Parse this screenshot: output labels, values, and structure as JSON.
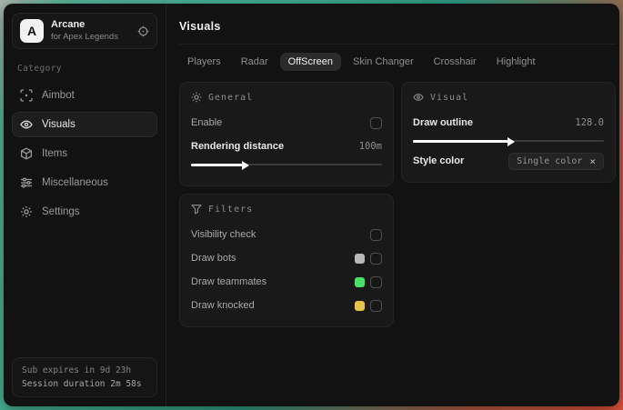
{
  "app": {
    "logo_letter": "A",
    "name": "Arcane",
    "subtitle": "for Apex Legends"
  },
  "sidebar": {
    "category_label": "Category",
    "items": [
      {
        "label": "Aimbot",
        "icon": "scan-icon",
        "active": false
      },
      {
        "label": "Visuals",
        "icon": "eye-icon",
        "active": true
      },
      {
        "label": "Items",
        "icon": "box-icon",
        "active": false
      },
      {
        "label": "Miscellaneous",
        "icon": "sliders-icon",
        "active": false
      },
      {
        "label": "Settings",
        "icon": "gear-icon",
        "active": false
      }
    ],
    "footer": {
      "line1": "Sub expires in 9d 23h",
      "line2": "Session duration 2m 58s"
    }
  },
  "main": {
    "title": "Visuals",
    "tabs": [
      {
        "label": "Players",
        "active": false
      },
      {
        "label": "Radar",
        "active": false
      },
      {
        "label": "OffScreen",
        "active": true
      },
      {
        "label": "Skin Changer",
        "active": false
      },
      {
        "label": "Crosshair",
        "active": false
      },
      {
        "label": "Highlight",
        "active": false
      }
    ],
    "general": {
      "title": "General",
      "enable_label": "Enable",
      "enable_checked": false,
      "rendering_label": "Rendering distance",
      "rendering_value": "100m",
      "rendering_fill": "27%"
    },
    "filters": {
      "title": "Filters",
      "rows": [
        {
          "label": "Visibility check",
          "checked": false
        },
        {
          "label": "Draw bots",
          "swatch": "#b8b8b8",
          "checked": false
        },
        {
          "label": "Draw teammates",
          "swatch": "#4ade6b",
          "checked": false
        },
        {
          "label": "Draw knocked",
          "swatch": "#e3c44d",
          "checked": false
        }
      ]
    },
    "visual": {
      "title": "Visual",
      "outline_label": "Draw outline",
      "outline_value": "128.0",
      "outline_fill": "50%",
      "style_label": "Style color",
      "style_value": "Single color",
      "clear_glyph": "×"
    }
  },
  "colors": {
    "desktop_teal": "#3fae90",
    "desktop_red": "#e0513a",
    "swatch_gray": "#b8b8b8",
    "swatch_green": "#4ade6b",
    "swatch_yellow": "#e3c44d",
    "slider_fill": "#ffffff",
    "tab_active_bg": "#2b2b2b"
  }
}
